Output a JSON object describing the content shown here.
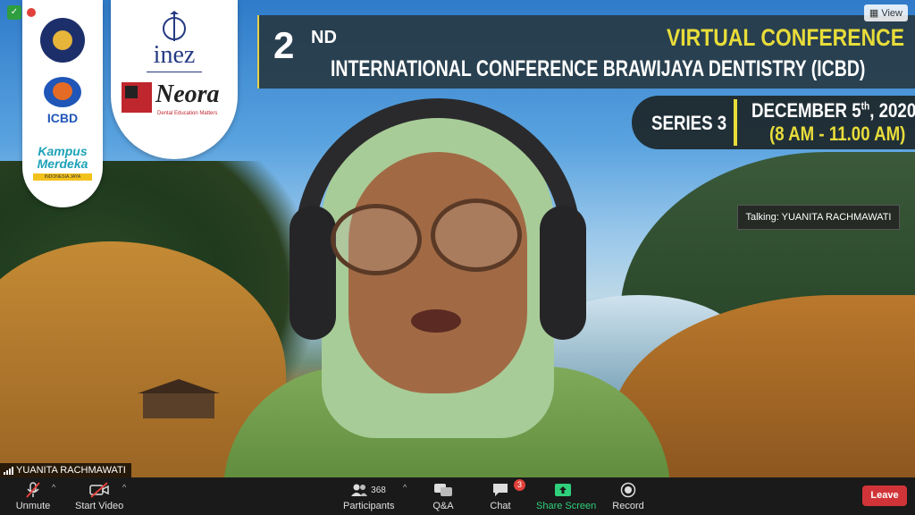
{
  "recording": {
    "label": "Recording"
  },
  "view_button": {
    "label": "View"
  },
  "logos": {
    "icbd": "ICBD",
    "kampus_merdeka": "Kampus Merdeka",
    "kampus_merdeka_sub": "INDONESIA JAYA",
    "inez": "inez",
    "neora": "Neora",
    "neora_sub": "Dental Education Matters"
  },
  "banner": {
    "edition_number": "2",
    "edition_suffix": "ND",
    "virtual_conference": "VIRTUAL CONFERENCE",
    "title": "INTERNATIONAL CONFERENCE BRAWIJAYA DENTISTRY (ICBD)"
  },
  "series": {
    "label": "SERIES 3",
    "date_prefix": "DECEMBER 5",
    "date_suffix": "th",
    "date_year": ", 2020",
    "time": "(8 AM - 11.00 AM)"
  },
  "talking_indicator": "Talking: YUANITA RACHMAWATI",
  "speaker_name": "YUANITA RACHMAWATI",
  "toolbar": {
    "unmute": "Unmute",
    "start_video": "Start Video",
    "participants_count": "368",
    "participants": "Participants",
    "qa": "Q&A",
    "chat": "Chat",
    "chat_badge": "3",
    "share_screen": "Share Screen",
    "record": "Record",
    "leave": "Leave"
  },
  "colors": {
    "accent_yellow": "#e8dd3a",
    "share_green": "#2fd07b",
    "leave_red": "#d13438",
    "badge_red": "#e0413a"
  }
}
